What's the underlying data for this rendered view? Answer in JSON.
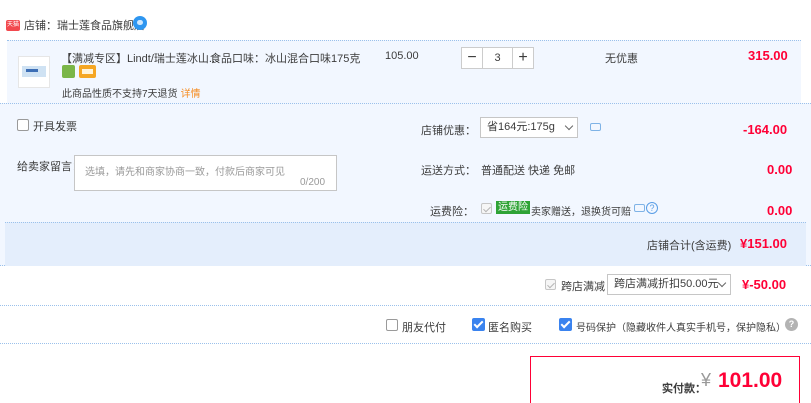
{
  "store": {
    "badge": "天猫",
    "name": "店铺：瑞士莲食品旗舰店"
  },
  "item": {
    "title": "【满减专区】Lindt/瑞士莲冰山...",
    "attr": "食品口味：冰山混合口味175克",
    "no_return": "此商品性质不支持7天退货",
    "detail_link": "详情",
    "unit_price": "105.00",
    "qty_minus": "−",
    "qty_value": "3",
    "qty_plus": "+",
    "discount": "无优惠",
    "total": "315.00"
  },
  "invoice": {
    "label": "开具发票"
  },
  "memo": {
    "label": "给卖家留言：",
    "placeholder": "选填，请先和商家协商一致，付款后商家可见",
    "count": "0/200"
  },
  "shop_discount": {
    "label": "店铺优惠：",
    "selected": "省164元:175g",
    "amount": "-164.00"
  },
  "shipping": {
    "label": "运送方式：",
    "value": "普通配送 快递 免邮",
    "amount": "0.00"
  },
  "insurance": {
    "label": "运费险：",
    "badge": "运费险",
    "text": "卖家赠送，退换货可赔",
    "help": "?",
    "amount": "0.00"
  },
  "subtotal": {
    "label": "店铺合计(含运费)",
    "amount": "¥151.00"
  },
  "cross_store": {
    "label": "跨店满减",
    "selected": "跨店满减折扣50.00元",
    "amount": "¥-50.00"
  },
  "options": {
    "friend_pay": "朋友代付",
    "anonymous": "匿名购买",
    "privacy": "号码保护（隐藏收件人真实手机号，保护隐私）",
    "help": "?"
  },
  "payment": {
    "label": "实付款：",
    "currency": "¥",
    "amount": "101.00"
  },
  "colors": {
    "accent_red": "#ff0036",
    "panel_bg": "#f2f7ff",
    "checkbox_blue": "#3a83ef"
  }
}
